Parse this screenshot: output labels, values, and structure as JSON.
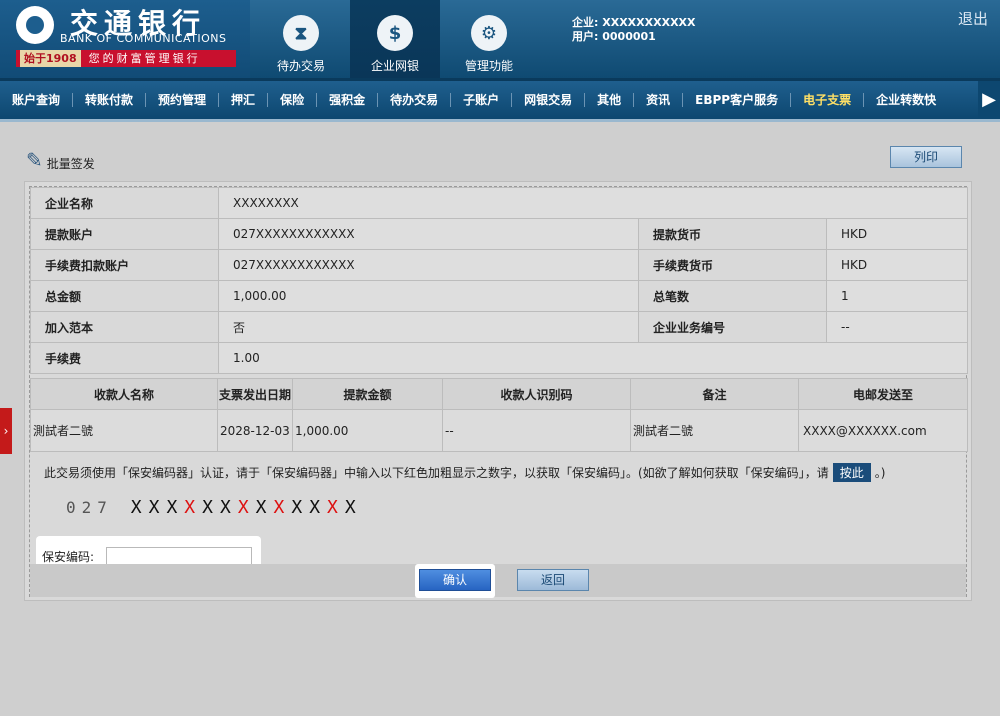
{
  "brand": {
    "name_cn": "交通银行",
    "name_en": "BANK OF COMMUNICATIONS",
    "since": "始于1908",
    "slogan": "您的财富管理银行"
  },
  "topnav": [
    {
      "label": "待办交易",
      "icon": "hourglass-icon"
    },
    {
      "label": "企业网银",
      "icon": "monitor-icon"
    },
    {
      "label": "管理功能",
      "icon": "gears-icon"
    }
  ],
  "user": {
    "company": "企业: XXXXXXXXXXX",
    "user": "用户: 0000001"
  },
  "logout": "退出",
  "menu": [
    "账户查询",
    "转账付款",
    "预约管理",
    "押汇",
    "保险",
    "强积金",
    "待办交易",
    "子账户",
    "网银交易",
    "其他",
    "资讯",
    "EBPP客户服务",
    "电子支票",
    "企业转数快"
  ],
  "page": {
    "title": "批量签发",
    "print": "列印"
  },
  "info": {
    "company_name_label": "企业名称",
    "company_name": "XXXXXXXX",
    "withdraw_account_label": "提款账户",
    "withdraw_account": "027XXXXXXXXXXXX",
    "withdraw_currency_label": "提款货币",
    "withdraw_currency": "HKD",
    "fee_account_label": "手续费扣款账户",
    "fee_account": "027XXXXXXXXXXXX",
    "fee_currency_label": "手续费货币",
    "fee_currency": "HKD",
    "total_amount_label": "总金额",
    "total_amount": "1,000.00",
    "total_count_label": "总笔数",
    "total_count": "1",
    "add_template_label": "加入范本",
    "add_template": "否",
    "biz_no_label": "企业业务编号",
    "biz_no": "--",
    "fee_label": "手续费",
    "fee": "1.00"
  },
  "recipients": {
    "headers": [
      "收款人名称",
      "支票发出日期",
      "提款金额",
      "收款人识别码",
      "备注",
      "电邮发送至"
    ],
    "rows": [
      [
        "測試者二號",
        "2028-12-03",
        "1,000.00",
        "--",
        "測試者二號",
        "XXXX@XXXXXX.com"
      ]
    ]
  },
  "security": {
    "notice_pre": "此交易须使用「保安编码器」认证，请于「保安编码器」中输入以下红色加粗显示之数字，以获取「保安编码」。(如欲了解如何获取「保安编码」，请",
    "notice_link": "按此",
    "notice_post": "。)",
    "code_prefix": "027",
    "code_chars": [
      "X",
      "X",
      "X",
      "X",
      "X",
      "X",
      "X",
      "X",
      "X",
      "X",
      "X",
      "X",
      "X"
    ],
    "code_red": [
      false,
      false,
      false,
      true,
      false,
      false,
      true,
      false,
      true,
      false,
      false,
      true,
      false
    ],
    "label": "保安编码:",
    "value": ""
  },
  "buttons": {
    "confirm": "确认",
    "back": "返回"
  },
  "colors": {
    "brand_blue": "#1d5e8e",
    "brand_red": "#c8102e",
    "highlight_yellow": "#ffe066",
    "code_red": "#dd1111"
  }
}
